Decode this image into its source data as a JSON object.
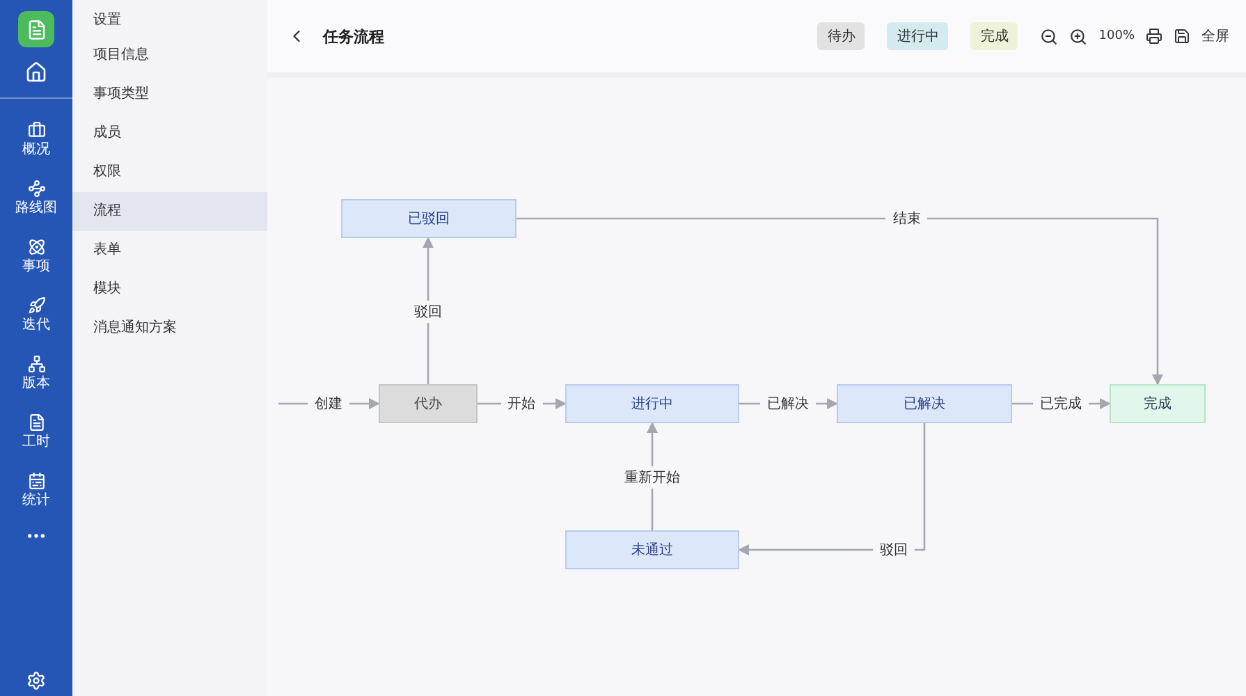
{
  "rail": {
    "items": [
      {
        "label": "概况"
      },
      {
        "label": "路线图"
      },
      {
        "label": "事项"
      },
      {
        "label": "迭代"
      },
      {
        "label": "版本"
      },
      {
        "label": "工时"
      },
      {
        "label": "统计"
      }
    ]
  },
  "settings_nav": {
    "title": "设置",
    "items": [
      {
        "label": "项目信息",
        "selected": false
      },
      {
        "label": "事项类型",
        "selected": false
      },
      {
        "label": "成员",
        "selected": false
      },
      {
        "label": "权限",
        "selected": false
      },
      {
        "label": "流程",
        "selected": true
      },
      {
        "label": "表单",
        "selected": false
      },
      {
        "label": "模块",
        "selected": false
      },
      {
        "label": "消息通知方案",
        "selected": false
      }
    ]
  },
  "toolbar": {
    "title": "任务流程",
    "legend": [
      {
        "label": "待办",
        "kind": "todo"
      },
      {
        "label": "进行中",
        "kind": "active"
      },
      {
        "label": "完成",
        "kind": "done"
      }
    ],
    "zoom": "100%",
    "fullscreen": "全屏"
  },
  "diagram": {
    "nodes": [
      {
        "label": "已驳回",
        "kind": "active"
      },
      {
        "label": "代办",
        "kind": "todo"
      },
      {
        "label": "进行中",
        "kind": "active"
      },
      {
        "label": "已解决",
        "kind": "active"
      },
      {
        "label": "完成",
        "kind": "done"
      },
      {
        "label": "未通过",
        "kind": "active"
      }
    ],
    "edges": [
      {
        "label": "创建"
      },
      {
        "label": "驳回"
      },
      {
        "label": "结束"
      },
      {
        "label": "开始"
      },
      {
        "label": "已解决"
      },
      {
        "label": "已完成"
      },
      {
        "label": "驳回"
      },
      {
        "label": "重新开始"
      }
    ]
  }
}
